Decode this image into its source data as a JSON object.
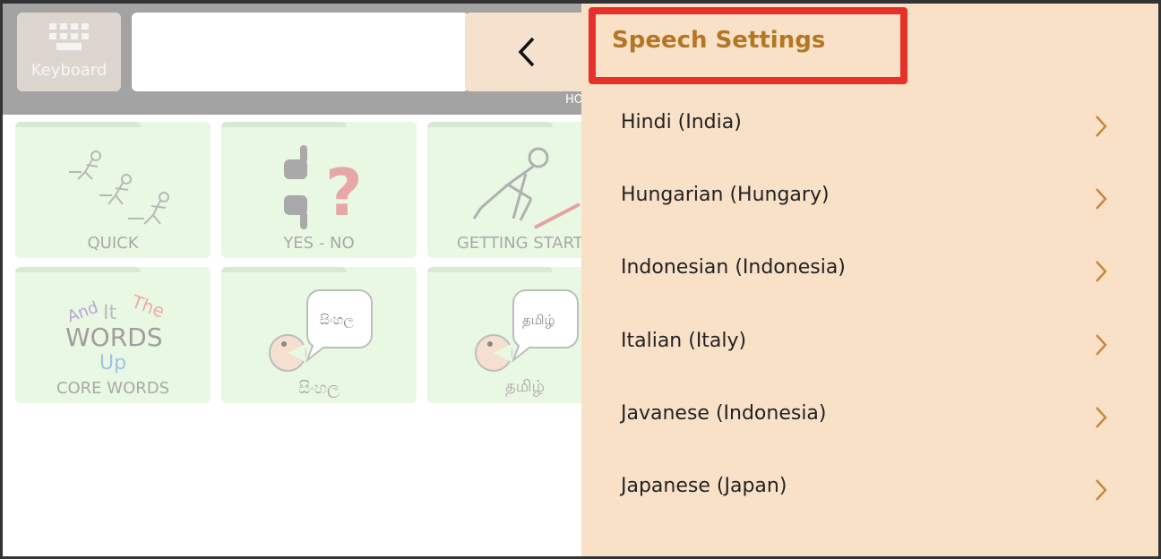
{
  "top_bar": {
    "keyboard_label": "Keyboard",
    "message_text": "",
    "home_partial": "HO"
  },
  "tiles": [
    {
      "label": "QUICK",
      "icon": "running-figures-icon"
    },
    {
      "label": "YES - NO",
      "icon": "thumbs-question-icon"
    },
    {
      "label": "GETTING STARTE",
      "icon": "starting-figure-icon"
    },
    {
      "label": "CORE WORDS",
      "icon": "core-words-icon",
      "art_words": [
        "And",
        "It",
        "The",
        "WORDS",
        "Up"
      ]
    },
    {
      "label": "සිංහල",
      "icon": "sinhala-speech-icon",
      "bubble_text": "සිංහල"
    },
    {
      "label": "தமிழ்",
      "icon": "tamil-speech-icon",
      "bubble_text": "தமிழ்"
    }
  ],
  "panel": {
    "title": "Speech Settings",
    "languages": [
      {
        "label": "Hindi (India)"
      },
      {
        "label": "Hungarian (Hungary)"
      },
      {
        "label": "Indonesian (Indonesia)"
      },
      {
        "label": "Italian (Italy)"
      },
      {
        "label": "Javanese (Indonesia)"
      },
      {
        "label": "Japanese (Japan)"
      }
    ]
  },
  "colors": {
    "panel_bg": "#f9e1c8",
    "title_color": "#b57624",
    "highlight_border": "#e8302a",
    "chevron": "#c8893a",
    "tile_bg": "#e9f8e2"
  }
}
